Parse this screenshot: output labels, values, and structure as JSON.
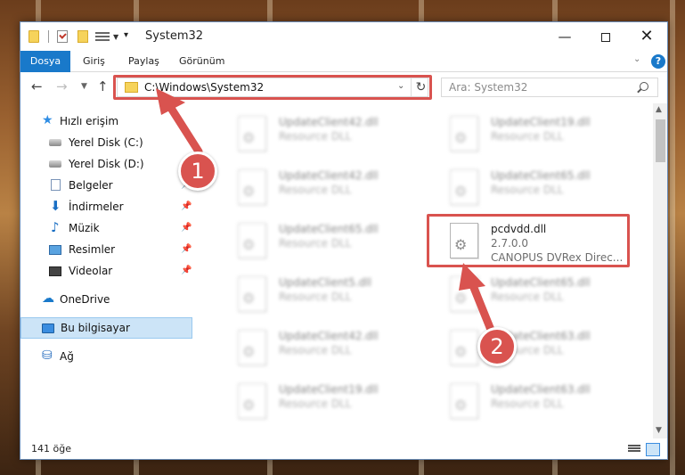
{
  "window": {
    "title": "System32",
    "minimize_glyph": "—",
    "close_glyph": "✕"
  },
  "ribbon": {
    "tabs": [
      "Dosya",
      "Giriş",
      "Paylaş",
      "Görünüm"
    ],
    "help_glyph": "?",
    "active_color": "#1979ca"
  },
  "address_bar": {
    "path": "C:\\Windows\\System32",
    "refresh_glyph": "↻"
  },
  "search": {
    "placeholder": "Ara: System32"
  },
  "sidebar": {
    "items": [
      {
        "label": "Hızlı erişim",
        "icon": "star-icon",
        "pinned": false
      },
      {
        "label": "Yerel Disk (C:)",
        "icon": "drive-icon",
        "pinned": false
      },
      {
        "label": "Yerel Disk (D:)",
        "icon": "drive-icon",
        "pinned": false
      },
      {
        "label": "Belgeler",
        "icon": "documents-icon",
        "pinned": true
      },
      {
        "label": "İndirmeler",
        "icon": "download-icon",
        "pinned": true
      },
      {
        "label": "Müzik",
        "icon": "music-icon",
        "pinned": true
      },
      {
        "label": "Resimler",
        "icon": "pictures-icon",
        "pinned": true
      },
      {
        "label": "Videolar",
        "icon": "videos-icon",
        "pinned": true
      },
      {
        "label": "OneDrive",
        "icon": "cloud-icon",
        "pinned": false
      },
      {
        "label": "Bu bilgisayar",
        "icon": "computer-icon",
        "pinned": false,
        "selected": true
      },
      {
        "label": "Ağ",
        "icon": "network-icon",
        "pinned": false
      }
    ]
  },
  "files": [
    {
      "name": "UpdateClient42.dll",
      "desc": "Resource DLL",
      "blurred": true
    },
    {
      "name": "UpdateClient19.dll",
      "desc": "Resource DLL",
      "blurred": true
    },
    {
      "name": "UpdateClient42.dll",
      "desc": "Resource DLL",
      "blurred": true
    },
    {
      "name": "UpdateClient65.dll",
      "desc": "Resource DLL",
      "blurred": true
    },
    {
      "name": "UpdateClient65.dll",
      "desc": "Resource DLL",
      "blurred": true
    },
    {
      "name": "pcdvdd.dll",
      "desc": "2.7.0.0",
      "desc2": "CANOPUS DVRex Direc...",
      "blurred": false,
      "highlighted": true
    },
    {
      "name": "UpdateClient5.dll",
      "desc": "Resource DLL",
      "blurred": true
    },
    {
      "name": "UpdateClient65.dll",
      "desc": "Resource DLL",
      "blurred": true
    },
    {
      "name": "UpdateClient42.dll",
      "desc": "Resource DLL",
      "blurred": true
    },
    {
      "name": "UpdateClient63.dll",
      "desc": "Resource DLL",
      "blurred": true
    },
    {
      "name": "UpdateClient19.dll",
      "desc": "Resource DLL",
      "blurred": true
    },
    {
      "name": "UpdateClient63.dll",
      "desc": "Resource DLL",
      "blurred": true
    }
  ],
  "status": {
    "item_count": "141 öğe"
  },
  "annotations": {
    "badge_1": "1",
    "badge_2": "2",
    "color": "#d9534f"
  }
}
